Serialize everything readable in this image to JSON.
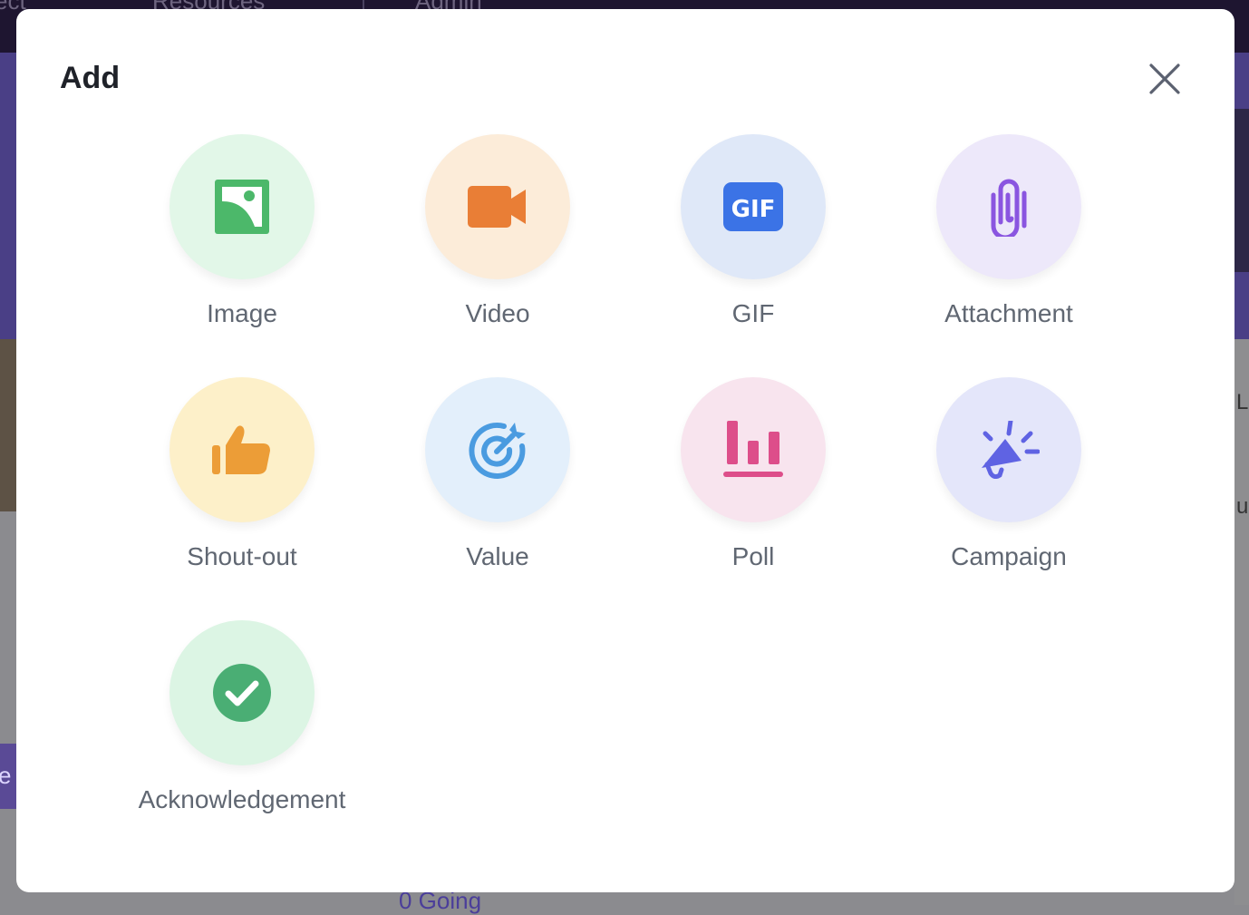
{
  "background": {
    "nav_items": [
      "ect",
      "Resources",
      "Admin"
    ],
    "right_snippet_1": "L",
    "right_snippet_2": "u",
    "left_snippet": "e y",
    "bottom_text": "0 Going"
  },
  "modal": {
    "title": "Add",
    "close_icon": "close-icon",
    "options": [
      {
        "label": "Image",
        "icon": "image-icon",
        "bg": "#e2f7e8",
        "color": "#4cb86a"
      },
      {
        "label": "Video",
        "icon": "video-camera-icon",
        "bg": "#fcecd9",
        "color": "#e97e36"
      },
      {
        "label": "GIF",
        "icon": "gif-icon",
        "bg": "#dfe8f8",
        "color": "#3b73e6"
      },
      {
        "label": "Attachment",
        "icon": "paperclip-icon",
        "bg": "#ede8fa",
        "color": "#8a55e0"
      },
      {
        "label": "Shout-out",
        "icon": "thumbs-up-icon",
        "bg": "#fdf0c9",
        "color": "#ec9d37"
      },
      {
        "label": "Value",
        "icon": "target-icon",
        "bg": "#e3effb",
        "color": "#4a9be0"
      },
      {
        "label": "Poll",
        "icon": "bar-chart-icon",
        "bg": "#f8e4ee",
        "color": "#dd4e8a"
      },
      {
        "label": "Campaign",
        "icon": "megaphone-icon",
        "bg": "#e4e6fa",
        "color": "#5f63e3"
      },
      {
        "label": "Acknowledgement",
        "icon": "check-circle-icon",
        "bg": "#dcf5e4",
        "color": "#4aae74"
      }
    ]
  }
}
